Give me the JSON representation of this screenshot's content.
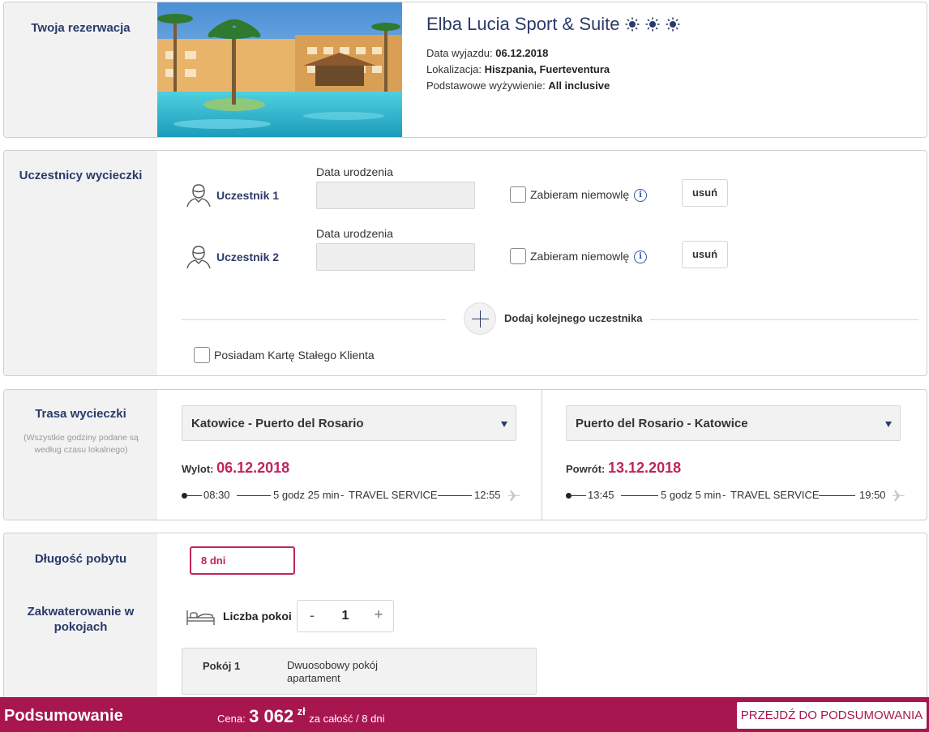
{
  "booking": {
    "section_title": "Twoja rezerwacja",
    "hotel_name": "Elba Lucia Sport & Suite",
    "stars": 3,
    "departure_label": "Data wyjazdu:",
    "departure_value": "06.12.2018",
    "location_label": "Lokalizacja:",
    "location_value": "Hiszpania, Fuerteventura",
    "board_label": "Podstawowe wyżywienie:",
    "board_value": "All inclusive"
  },
  "participants": {
    "section_title": "Uczestnicy wycieczki",
    "list": [
      {
        "name": "Uczestnik 1",
        "date_label": "Data urodzenia",
        "date_value": "",
        "infant_label": "Zabieram niemowlę",
        "remove_label": "usuń"
      },
      {
        "name": "Uczestnik 2",
        "date_label": "Data urodzenia",
        "date_value": "",
        "infant_label": "Zabieram niemowlę",
        "remove_label": "usuń"
      }
    ],
    "add_label": "Dodaj kolejnego uczestnika",
    "loyalty_label": "Posiadam Kartę Stałego Klienta"
  },
  "route": {
    "section_title": "Trasa wycieczki",
    "note": "(Wszystkie godziny podane są według czasu lokalnego)",
    "outbound": {
      "select_value": "Katowice - Puerto del Rosario",
      "label": "Wylot:",
      "date": "06.12.2018",
      "dep_time": "08:30",
      "duration": "5 godz 25 min",
      "separator": "-",
      "carrier": "TRAVEL SERVICE",
      "arr_time": "12:55"
    },
    "inbound": {
      "select_value": "Puerto del Rosario - Katowice",
      "label": "Powrót:",
      "date": "13.12.2018",
      "dep_time": "13:45",
      "duration": "5 godz 5 min",
      "separator": "-",
      "carrier": "TRAVEL SERVICE",
      "arr_time": "19:50"
    }
  },
  "stay": {
    "section_title": "Długość pobytu",
    "value": "8 dni"
  },
  "rooms": {
    "section_title": "Zakwaterowanie w pokojach",
    "count_label": "Liczba pokoi",
    "minus": "-",
    "count": "1",
    "plus": "+",
    "room_name": "Pokój 1",
    "room_type": "Dwuosobowy pokój apartament"
  },
  "footer": {
    "title": "Podsumowanie",
    "price_label": "Cena:",
    "price": "3 062",
    "currency": "zł",
    "price_suffix": "za całość / 8 dni",
    "button": "PRZEJDŹ DO PODSUMOWANIA"
  },
  "colors": {
    "navy": "#2b3a6b",
    "accent": "#c0245e",
    "footer": "#a8164f"
  }
}
